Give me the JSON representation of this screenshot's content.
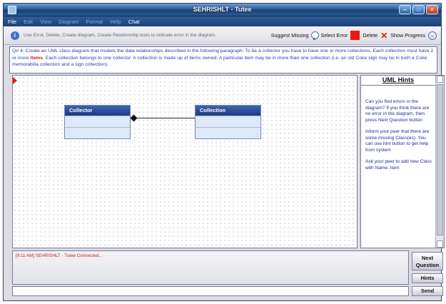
{
  "window": {
    "title": "SEHRISHLT - Tutee",
    "controls": [
      "minimize",
      "maximize",
      "close"
    ]
  },
  "menu": [
    {
      "label": "File",
      "enabled": true
    },
    {
      "label": "Edit",
      "enabled": false
    },
    {
      "label": "View",
      "enabled": false
    },
    {
      "label": "Diagram",
      "enabled": false
    },
    {
      "label": "Format",
      "enabled": false
    },
    {
      "label": "Help",
      "enabled": false
    },
    {
      "label": "Chat",
      "enabled": true
    }
  ],
  "toolbar": {
    "info_icon": "info-icon",
    "hint": "Use Error, Delete, Create diagram, Create Relationship tools to indicate error in the diagram.",
    "suggest_missing": "Suggest Missing",
    "select_error": "Select Error",
    "delete": "Delete",
    "show_progress": "Show Progress",
    "error_color": "#e81a10"
  },
  "question": {
    "before": "Q# 4: Create an UML class diagram that models the data relationships described in the following paragraph. To be a collector you have to have one or more collections. Each collection must have 2 or more ",
    "emphasis": "items",
    "after": ". Each collection belongs to one collector. A collection is made up of items owned. A particular item may be in more than one collection (i.e. an old Coke sign may be in both a Coke memorabilia collection and a sign collection)."
  },
  "diagram": {
    "classes": [
      {
        "name": "Collector"
      },
      {
        "name": "Collection"
      }
    ],
    "association": {
      "from": "Collector",
      "to": "Collection",
      "end": "composition-diamond"
    }
  },
  "hints": {
    "title": "UML Hints",
    "messages": [
      "Can you find errors in the diagram? If you think there are no error in the diagram, then press Next Question button",
      "Inform your peer that there are some missing Class(es). You can use hint button to get help from system",
      "Ask your peer to add new Class with Name: Item"
    ]
  },
  "chat": {
    "log": "[9:11 AM] SEHRISHLT - Tutee Connected...",
    "input_value": ""
  },
  "buttons": {
    "next_question_line1": "Next",
    "next_question_line2": "Question",
    "hints": "Hints",
    "send": "Send"
  },
  "colors": {
    "title_bar": "#2f5f9a",
    "class_header": "#2a4a94",
    "class_body": "#dde9f7",
    "question_text": "#2b3ab3",
    "hint_text": "#1e2a9a"
  }
}
